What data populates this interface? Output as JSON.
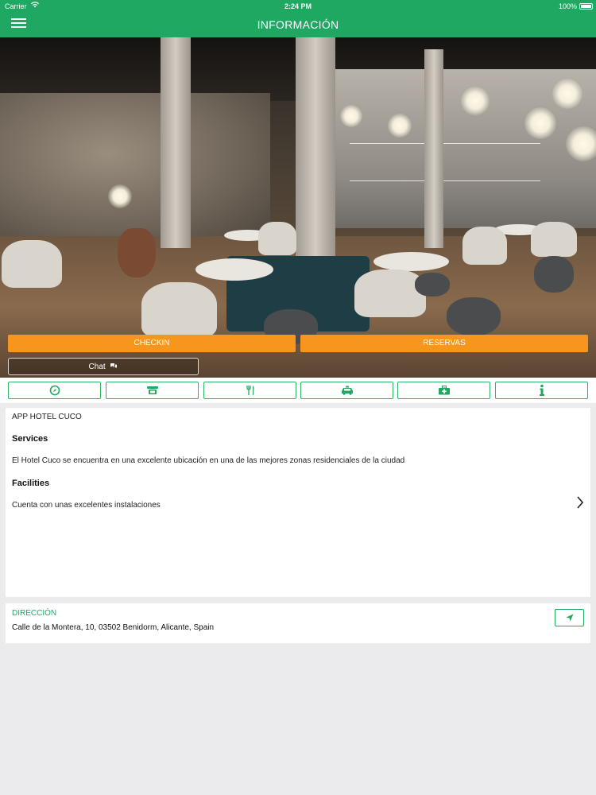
{
  "status_bar": {
    "carrier": "Carrier",
    "time": "2:24 PM",
    "battery": "100%"
  },
  "header": {
    "title": "INFORMACIÓN"
  },
  "actions": {
    "checkin_label": "CHECKIN",
    "reservas_label": "RESERVAS",
    "chat_label": "Chat"
  },
  "icon_bar": {
    "items": [
      {
        "icon": "compass-icon"
      },
      {
        "icon": "phone-icon"
      },
      {
        "icon": "restaurant-icon"
      },
      {
        "icon": "taxi-icon"
      },
      {
        "icon": "first-aid-icon"
      },
      {
        "icon": "info-icon"
      }
    ]
  },
  "info": {
    "app_name": "APP HOTEL CUCO",
    "services_heading": "Services",
    "services_text": "El Hotel Cuco se encuentra en una excelente ubicación en una de las mejores zonas residenciales de la ciudad",
    "facilities_heading": "Facilities",
    "facilities_text": "Cuenta con unas excelentes instalaciones"
  },
  "address": {
    "label": "DIRECCIÓN",
    "value": "Calle de la Montera, 10, 03502 Benidorm, Alicante, Spain"
  },
  "colors": {
    "brand_green": "#1fa862",
    "action_orange": "#f7961d"
  }
}
